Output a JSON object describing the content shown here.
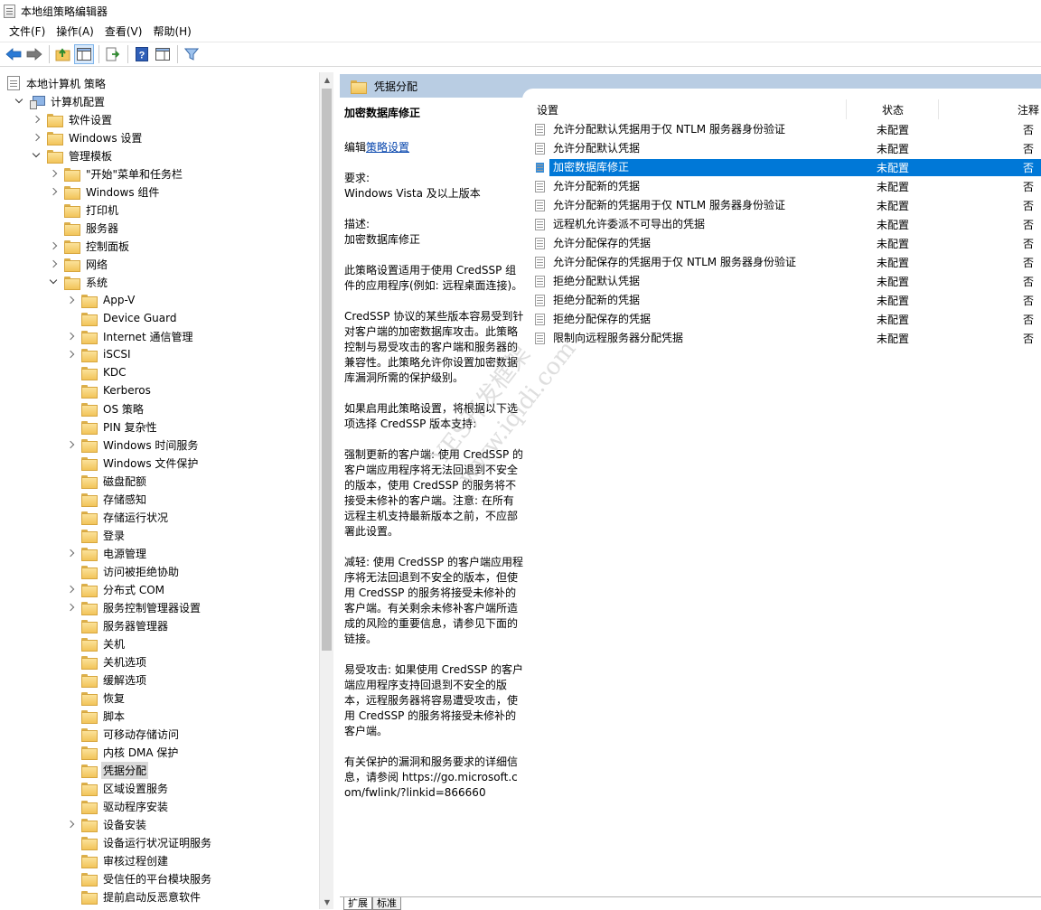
{
  "window": {
    "title": "本地组策略编辑器"
  },
  "menu": [
    "文件(F)",
    "操作(A)",
    "查看(V)",
    "帮助(H)"
  ],
  "tree": {
    "root": "本地计算机 策略",
    "items": [
      {
        "label": "计算机配置",
        "level": 1,
        "state": "expanded",
        "icon": "computer-icon"
      },
      {
        "label": "软件设置",
        "level": 2,
        "state": "collapsed"
      },
      {
        "label": "Windows 设置",
        "level": 2,
        "state": "collapsed"
      },
      {
        "label": "管理模板",
        "level": 2,
        "state": "expanded"
      },
      {
        "label": "\"开始\"菜单和任务栏",
        "level": 3,
        "state": "collapsed"
      },
      {
        "label": "Windows 组件",
        "level": 3,
        "state": "collapsed"
      },
      {
        "label": "打印机",
        "level": 3,
        "state": "none"
      },
      {
        "label": "服务器",
        "level": 3,
        "state": "none"
      },
      {
        "label": "控制面板",
        "level": 3,
        "state": "collapsed"
      },
      {
        "label": "网络",
        "level": 3,
        "state": "collapsed"
      },
      {
        "label": "系统",
        "level": 3,
        "state": "expanded"
      },
      {
        "label": "App-V",
        "level": 4,
        "state": "collapsed"
      },
      {
        "label": "Device Guard",
        "level": 4,
        "state": "none"
      },
      {
        "label": "Internet 通信管理",
        "level": 4,
        "state": "collapsed"
      },
      {
        "label": "iSCSI",
        "level": 4,
        "state": "collapsed"
      },
      {
        "label": "KDC",
        "level": 4,
        "state": "none"
      },
      {
        "label": "Kerberos",
        "level": 4,
        "state": "none"
      },
      {
        "label": "OS 策略",
        "level": 4,
        "state": "none"
      },
      {
        "label": "PIN 复杂性",
        "level": 4,
        "state": "none"
      },
      {
        "label": "Windows 时间服务",
        "level": 4,
        "state": "collapsed"
      },
      {
        "label": "Windows 文件保护",
        "level": 4,
        "state": "none"
      },
      {
        "label": "磁盘配额",
        "level": 4,
        "state": "none"
      },
      {
        "label": "存储感知",
        "level": 4,
        "state": "none"
      },
      {
        "label": "存储运行状况",
        "level": 4,
        "state": "none"
      },
      {
        "label": "登录",
        "level": 4,
        "state": "none"
      },
      {
        "label": "电源管理",
        "level": 4,
        "state": "collapsed"
      },
      {
        "label": "访问被拒绝协助",
        "level": 4,
        "state": "none"
      },
      {
        "label": "分布式 COM",
        "level": 4,
        "state": "collapsed"
      },
      {
        "label": "服务控制管理器设置",
        "level": 4,
        "state": "collapsed"
      },
      {
        "label": "服务器管理器",
        "level": 4,
        "state": "none"
      },
      {
        "label": "关机",
        "level": 4,
        "state": "none"
      },
      {
        "label": "关机选项",
        "level": 4,
        "state": "none"
      },
      {
        "label": "缓解选项",
        "level": 4,
        "state": "none"
      },
      {
        "label": "恢复",
        "level": 4,
        "state": "none"
      },
      {
        "label": "脚本",
        "level": 4,
        "state": "none"
      },
      {
        "label": "可移动存储访问",
        "level": 4,
        "state": "none"
      },
      {
        "label": "内核 DMA 保护",
        "level": 4,
        "state": "none"
      },
      {
        "label": "凭据分配",
        "level": 4,
        "state": "none",
        "selected": true
      },
      {
        "label": "区域设置服务",
        "level": 4,
        "state": "none"
      },
      {
        "label": "驱动程序安装",
        "level": 4,
        "state": "none"
      },
      {
        "label": "设备安装",
        "level": 4,
        "state": "collapsed"
      },
      {
        "label": "设备运行状况证明服务",
        "level": 4,
        "state": "none"
      },
      {
        "label": "审核过程创建",
        "level": 4,
        "state": "none"
      },
      {
        "label": "受信任的平台模块服务",
        "level": 4,
        "state": "none"
      },
      {
        "label": "提前启动反恶意软件",
        "level": 4,
        "state": "none"
      }
    ]
  },
  "header": {
    "title": "凭据分配"
  },
  "description": {
    "title": "加密数据库修正",
    "edit_prefix": "编辑",
    "edit_link": "策略设置",
    "req_label": "要求:",
    "req_value": "Windows Vista 及以上版本",
    "desc_label": "描述:",
    "desc_value": "加密数据库修正",
    "p1": "此策略设置适用于使用 CredSSP 组件的应用程序(例如: 远程桌面连接)。",
    "p2": "CredSSP 协议的某些版本容易受到针对客户端的加密数据库攻击。此策略控制与易受攻击的客户端和服务器的兼容性。此策略允许你设置加密数据库漏洞所需的保护级别。",
    "p3": "如果启用此策略设置，将根据以下选项选择 CredSSP 版本支持:",
    "p4": "强制更新的客户端: 使用 CredSSP 的客户端应用程序将无法回退到不安全的版本，使用 CredSSP 的服务将不接受未修补的客户端。注意: 在所有远程主机支持最新版本之前，不应部署此设置。",
    "p5": "减轻: 使用 CredSSP 的客户端应用程序将无法回退到不安全的版本，但使用 CredSSP 的服务将接受未修补的客户端。有关剩余未修补客户端所造成的风险的重要信息，请参见下面的链接。",
    "p6": "易受攻击: 如果使用 CredSSP 的客户端应用程序支持回退到不安全的版本，远程服务器将容易遭受攻击，使用 CredSSP 的服务将接受未修补的客户端。",
    "p7": "有关保护的漏洞和服务要求的详细信息，请参阅 https://go.microsoft.com/fwlink/?linkid=866660"
  },
  "list": {
    "columns": [
      "设置",
      "状态",
      "注释"
    ],
    "rows": [
      {
        "name": "允许分配默认凭据用于仅 NTLM 服务器身份验证",
        "state": "未配置",
        "note": "否"
      },
      {
        "name": "允许分配默认凭据",
        "state": "未配置",
        "note": "否"
      },
      {
        "name": "加密数据库修正",
        "state": "未配置",
        "note": "否",
        "selected": true
      },
      {
        "name": "允许分配新的凭据",
        "state": "未配置",
        "note": "否"
      },
      {
        "name": "允许分配新的凭据用于仅 NTLM 服务器身份验证",
        "state": "未配置",
        "note": "否"
      },
      {
        "name": "远程机允许委派不可导出的凭据",
        "state": "未配置",
        "note": "否"
      },
      {
        "name": "允许分配保存的凭据",
        "state": "未配置",
        "note": "否"
      },
      {
        "name": "允许分配保存的凭据用于仅 NTLM 服务器身份验证",
        "state": "未配置",
        "note": "否"
      },
      {
        "name": "拒绝分配默认凭据",
        "state": "未配置",
        "note": "否"
      },
      {
        "name": "拒绝分配新的凭据",
        "state": "未配置",
        "note": "否"
      },
      {
        "name": "拒绝分配保存的凭据",
        "state": "未配置",
        "note": "否"
      },
      {
        "name": "限制向远程服务器分配凭据",
        "state": "未配置",
        "note": "否"
      }
    ]
  },
  "tabs": [
    "扩展",
    "标准"
  ],
  "watermark": [
    "YES开发框架",
    "www.iqidi.com"
  ]
}
